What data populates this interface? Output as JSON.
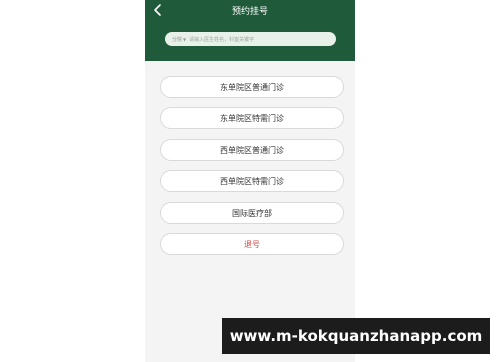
{
  "header": {
    "title": "预约挂号",
    "back_icon": "chevron-left-icon"
  },
  "search": {
    "scope_label": "分院",
    "placeholder": "请输入医生姓名，科室关键字"
  },
  "menu": {
    "items": [
      {
        "label": "东单院区普通门诊"
      },
      {
        "label": "东单院区特需门诊"
      },
      {
        "label": "西单院区普通门诊"
      },
      {
        "label": "西单院区特需门诊"
      },
      {
        "label": "国际医疗部"
      },
      {
        "label": "退号"
      }
    ]
  },
  "watermark": {
    "text": "www.m-kokquanzhanapp.com"
  },
  "colors": {
    "header_bg": "#1f5a3a",
    "cancel_text": "#d64545"
  }
}
